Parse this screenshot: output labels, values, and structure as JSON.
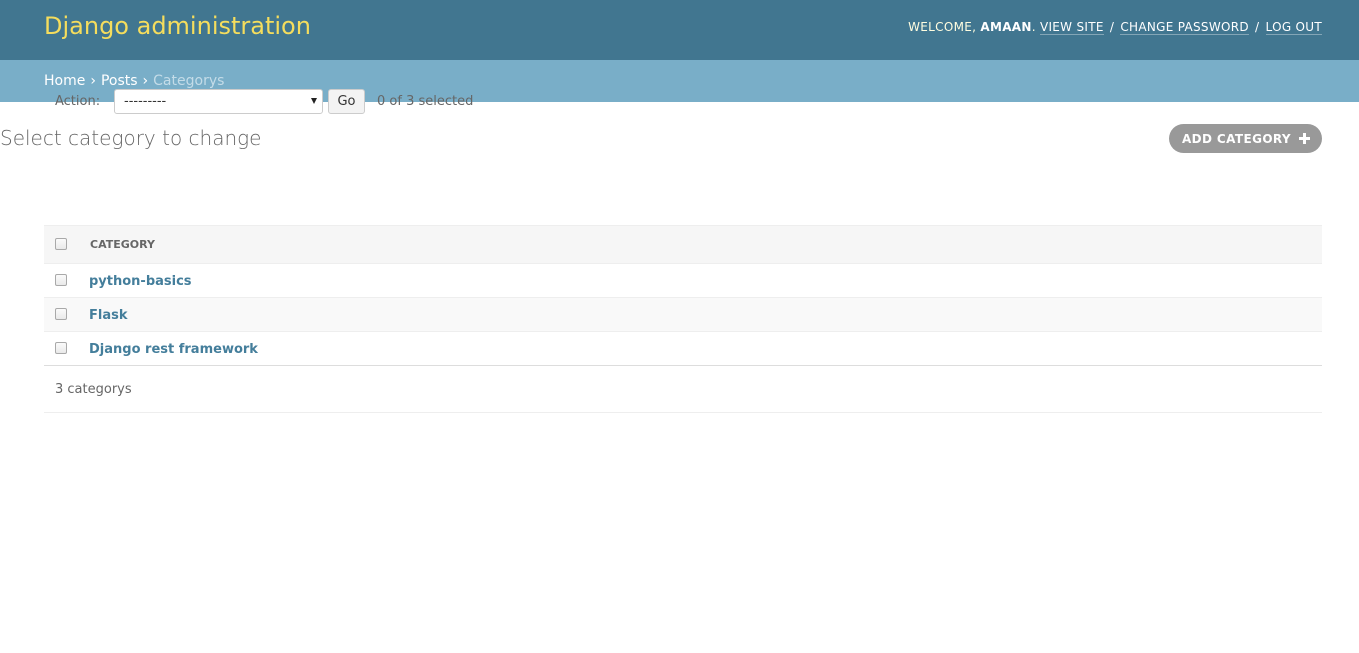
{
  "header": {
    "site_name": "Django administration",
    "welcome": "Welcome,",
    "username": "AMAAN",
    "view_site": "View site",
    "change_password": "Change password",
    "log_out": "Log out",
    "separator": "/",
    "colors": {
      "bar": "#417690",
      "site_name": "#f5dd5d"
    }
  },
  "breadcrumbs": {
    "home": "Home",
    "posts": "Posts",
    "current": "Categorys",
    "separator": "›"
  },
  "page": {
    "title": "Select category to change",
    "add_button": "Add category",
    "add_icon": "plus-icon"
  },
  "actions": {
    "label": "Action:",
    "selected_option": "---------",
    "go": "Go",
    "selected_count": "0 of 3 selected"
  },
  "table": {
    "column_header": "Category",
    "rows": [
      {
        "name": "python-basics"
      },
      {
        "name": "Flask"
      },
      {
        "name": "Django rest framework"
      }
    ]
  },
  "paginator": {
    "count_text": "3 categorys"
  }
}
